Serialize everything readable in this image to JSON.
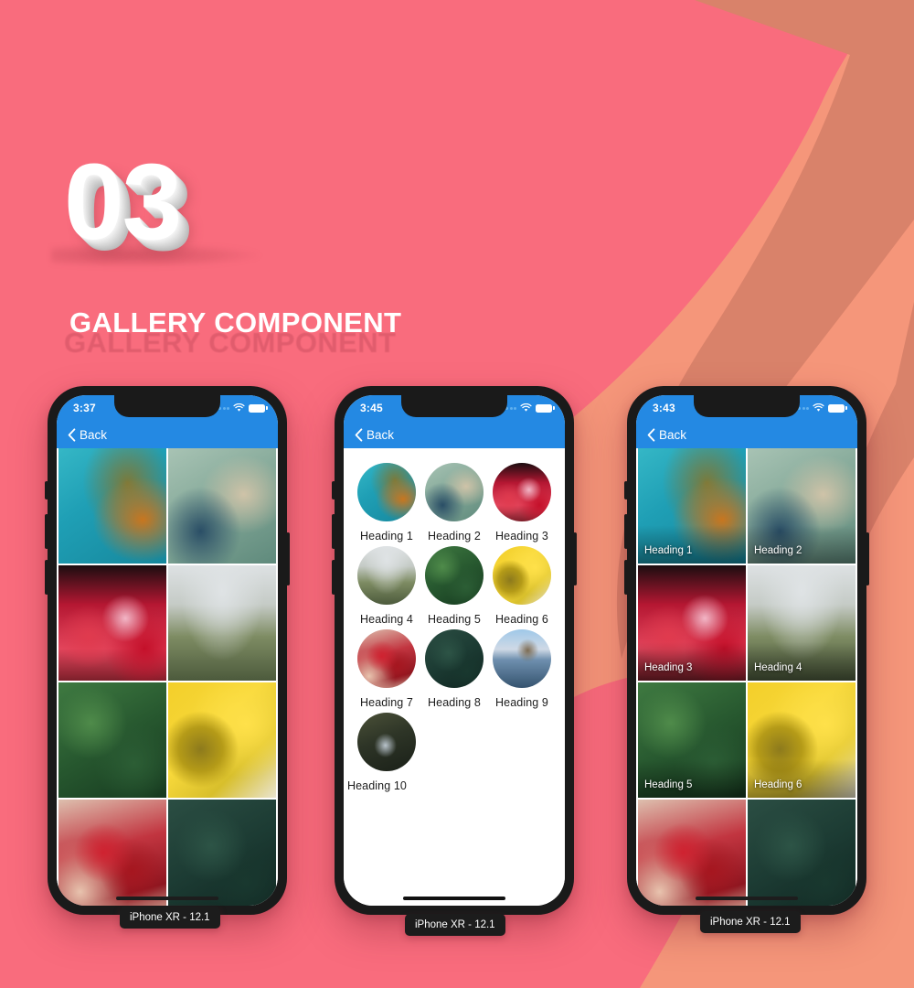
{
  "slide": {
    "number": "03",
    "title": "GALLERY COMPONENT",
    "title_echo": "GALLERY COMPONENT"
  },
  "colors": {
    "background_pink": "#f96c7d",
    "background_peach": "#f5967a",
    "background_band": "#d9826a",
    "navbar_blue": "#2489e3",
    "caption_bg": "#1c1c1c",
    "title_white": "#ffffff"
  },
  "phones": [
    {
      "caption": "iPhone XR - 12.1",
      "status": {
        "time": "3:37",
        "wifi_icon": "wifi-icon",
        "battery_icon": "battery-full-icon",
        "signal_icon": "signal-dots-icon"
      },
      "navbar": {
        "back_label": "Back",
        "back_icon": "chevron-left-icon"
      },
      "layout": "grid-plain",
      "tiles": [
        {
          "photo": "ph-1",
          "label": ""
        },
        {
          "photo": "ph-2",
          "label": ""
        },
        {
          "photo": "ph-3",
          "label": ""
        },
        {
          "photo": "ph-4",
          "label": ""
        },
        {
          "photo": "ph-5",
          "label": ""
        },
        {
          "photo": "ph-6",
          "label": ""
        },
        {
          "photo": "ph-7",
          "label": ""
        },
        {
          "photo": "ph-8",
          "label": ""
        }
      ]
    },
    {
      "caption": "iPhone XR - 12.1",
      "status": {
        "time": "3:45",
        "wifi_icon": "wifi-icon",
        "battery_icon": "battery-full-icon",
        "signal_icon": "signal-dots-icon"
      },
      "navbar": {
        "back_label": "Back",
        "back_icon": "chevron-left-icon"
      },
      "layout": "grid-circles",
      "tiles": [
        {
          "photo": "ph-1",
          "label": "Heading 1"
        },
        {
          "photo": "ph-2",
          "label": "Heading 2"
        },
        {
          "photo": "ph-3",
          "label": "Heading 3"
        },
        {
          "photo": "ph-4",
          "label": "Heading 4"
        },
        {
          "photo": "ph-5",
          "label": "Heading 5"
        },
        {
          "photo": "ph-6",
          "label": "Heading 6"
        },
        {
          "photo": "ph-7",
          "label": "Heading 7"
        },
        {
          "photo": "ph-8",
          "label": "Heading 8"
        },
        {
          "photo": "ph-9",
          "label": "Heading 9"
        },
        {
          "photo": "ph-10",
          "label": "Heading 10"
        }
      ]
    },
    {
      "caption": "iPhone XR - 12.1",
      "status": {
        "time": "3:43",
        "wifi_icon": "wifi-icon",
        "battery_icon": "battery-full-icon",
        "signal_icon": "signal-dots-icon"
      },
      "navbar": {
        "back_label": "Back",
        "back_icon": "chevron-left-icon"
      },
      "layout": "grid-labeled",
      "tiles": [
        {
          "photo": "ph-1",
          "label": "Heading 1"
        },
        {
          "photo": "ph-2",
          "label": "Heading 2"
        },
        {
          "photo": "ph-3",
          "label": "Heading 3"
        },
        {
          "photo": "ph-4",
          "label": "Heading 4"
        },
        {
          "photo": "ph-5",
          "label": "Heading 5"
        },
        {
          "photo": "ph-6",
          "label": "Heading 6"
        },
        {
          "photo": "ph-7",
          "label": ""
        },
        {
          "photo": "ph-8",
          "label": ""
        }
      ]
    }
  ]
}
